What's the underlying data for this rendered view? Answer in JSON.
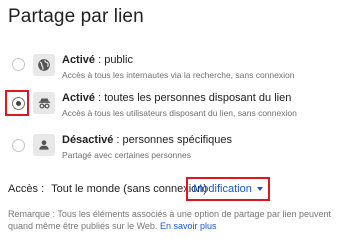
{
  "title": "Partage par lien",
  "options": [
    {
      "name": "Activé",
      "desc": " : public",
      "sub": "Accès à tous les internautes via la recherche, sans connexion",
      "icon": "globe-icon",
      "checked": false
    },
    {
      "name": "Activé",
      "desc": " : toutes les personnes disposant du lien",
      "sub": "Accès à tous les utilisateurs disposant du lien, sans connexion",
      "icon": "incognito-icon",
      "checked": true
    },
    {
      "name": "Désactivé",
      "desc": " : personnes spécifiques",
      "sub": "Partagé avec certaines personnes",
      "icon": "person-icon",
      "checked": false
    }
  ],
  "access": {
    "label": "Accès :",
    "value": "Tout le monde (sans connexion)",
    "modify_label": "Modification"
  },
  "remark": {
    "text": "Remarque : Tous les éléments associés à une option de partage par lien peuvent quand même être publiés sur le Web.",
    "link": "En savoir plus"
  },
  "colors": {
    "highlight": "#e0161e",
    "link": "#1558d6"
  }
}
